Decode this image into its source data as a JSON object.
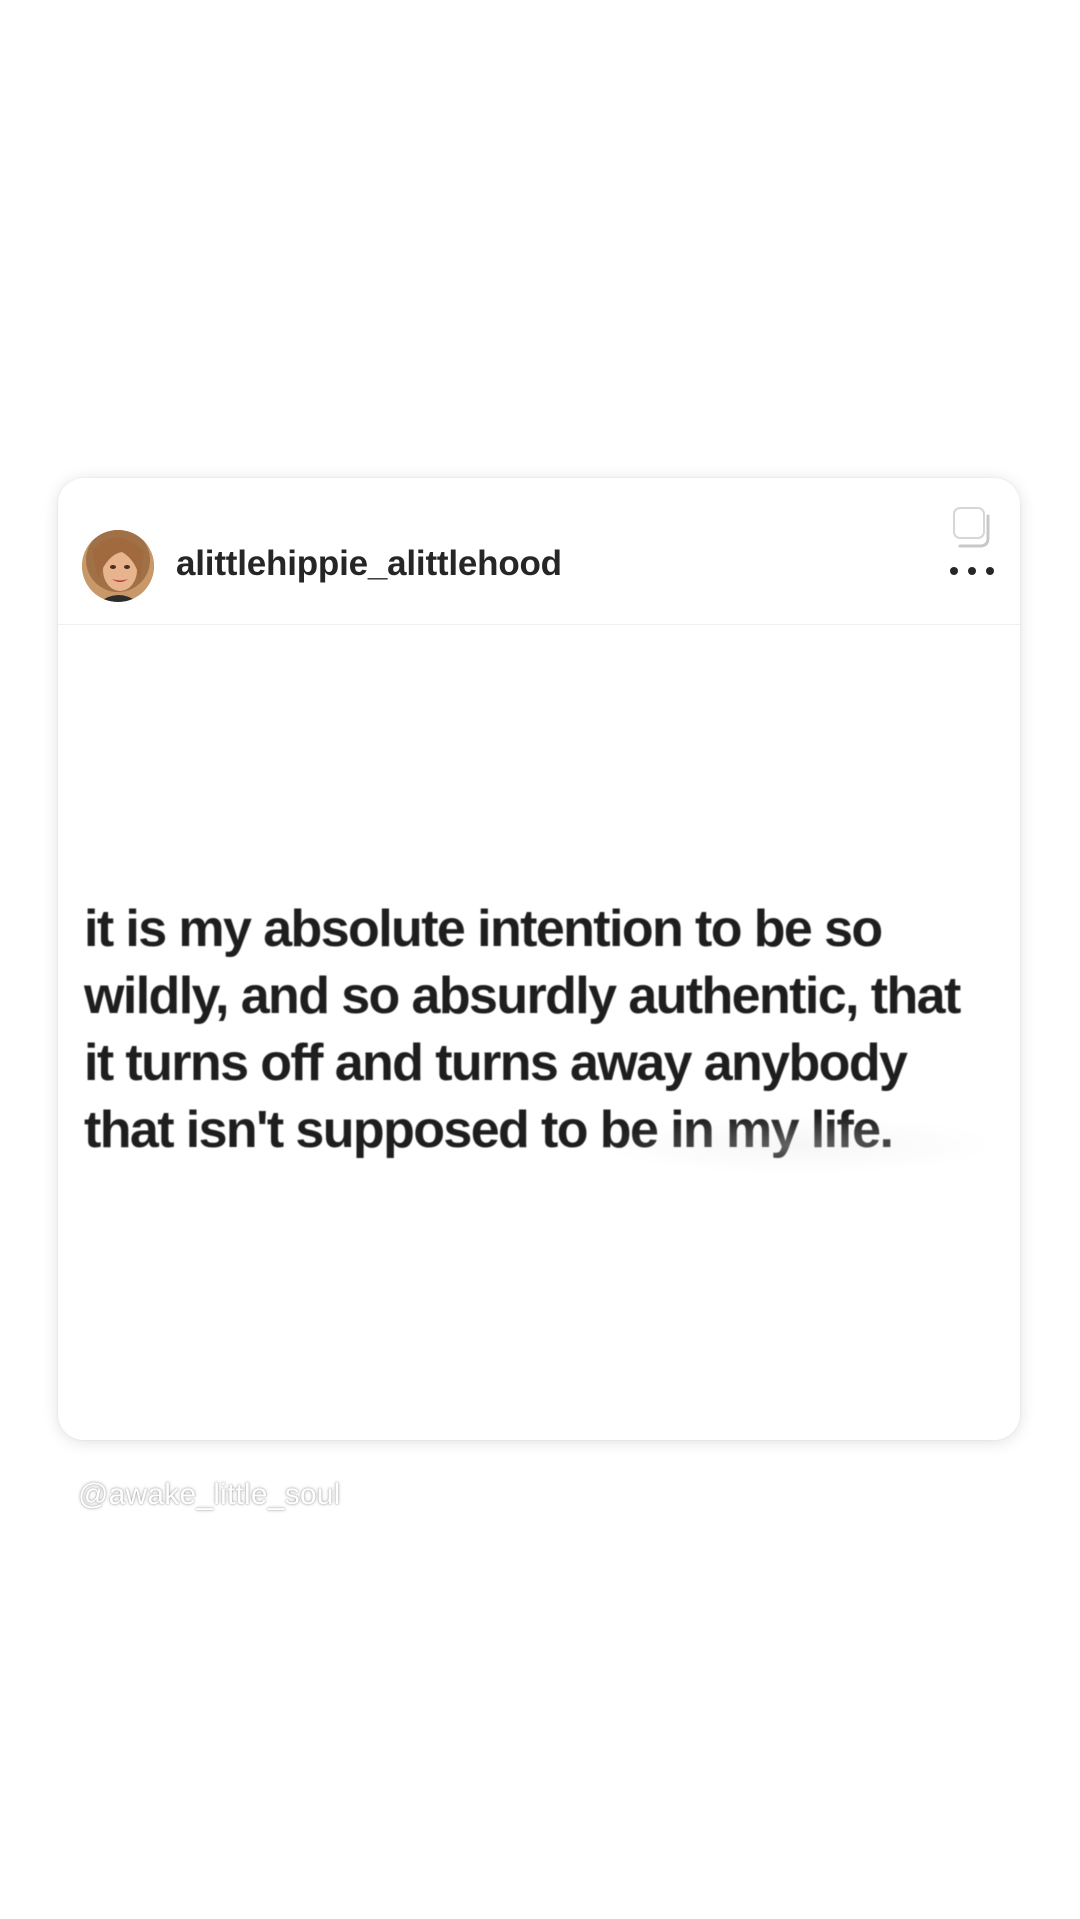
{
  "post": {
    "username": "alittlehippie_alittlehood",
    "quote": "it is my absolute intention to be so\nwildly, and so absurdly authentic, that\nit turns off and turns away anybody\nthat isn't supposed to be in my life."
  },
  "icons": {
    "avatar": "profile-photo",
    "carousel": "carousel-multiple-icon",
    "more": "more-options-icon"
  },
  "story": {
    "mention": "@awake_little_soul"
  },
  "colors": {
    "background": "#ffffff",
    "text": "#262626",
    "quote": "#1e1e1e"
  }
}
